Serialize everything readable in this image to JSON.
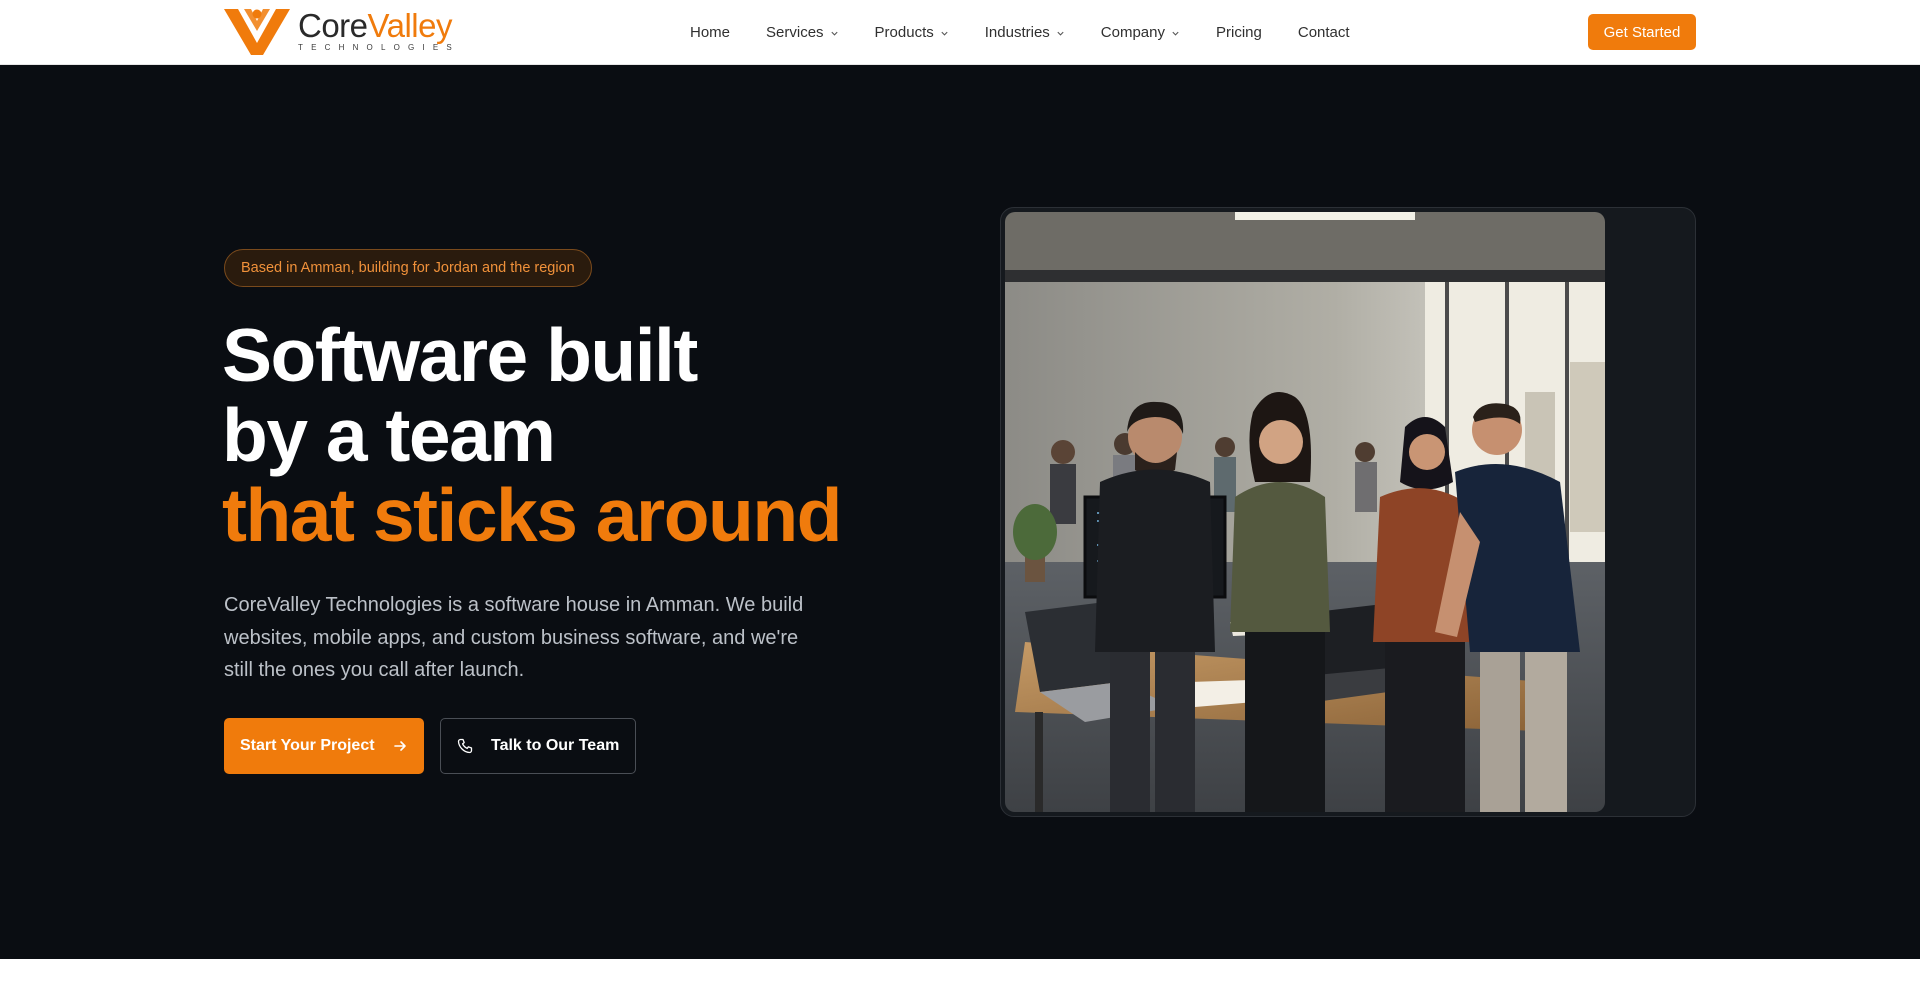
{
  "brand": {
    "name_part1": "Core",
    "name_part2": "Valley",
    "tagline": "TECHNOLOGIES",
    "accent_color": "#f07b0c"
  },
  "nav": {
    "items": [
      {
        "label": "Home",
        "has_dropdown": false
      },
      {
        "label": "Services",
        "has_dropdown": true
      },
      {
        "label": "Products",
        "has_dropdown": true
      },
      {
        "label": "Industries",
        "has_dropdown": true
      },
      {
        "label": "Company",
        "has_dropdown": true
      },
      {
        "label": "Pricing",
        "has_dropdown": false
      },
      {
        "label": "Contact",
        "has_dropdown": false
      }
    ],
    "cta_label": "Get Started",
    "dropdown_icon": "chevron-down-icon"
  },
  "hero": {
    "badge": "Based in Amman, building for Jordan and the region",
    "headline_line1": "Software built",
    "headline_line2": "by a team",
    "headline_line3": "that sticks around",
    "description": "CoreValley Technologies is a software house in Amman. We build websites, mobile apps, and custom business software, and we're still the ones you call after launch.",
    "primary_cta": "Start Your Project",
    "primary_cta_icon": "arrow-right-icon",
    "secondary_cta": "Talk to Our Team",
    "secondary_cta_icon": "phone-icon",
    "background_color": "#0a0d12"
  }
}
